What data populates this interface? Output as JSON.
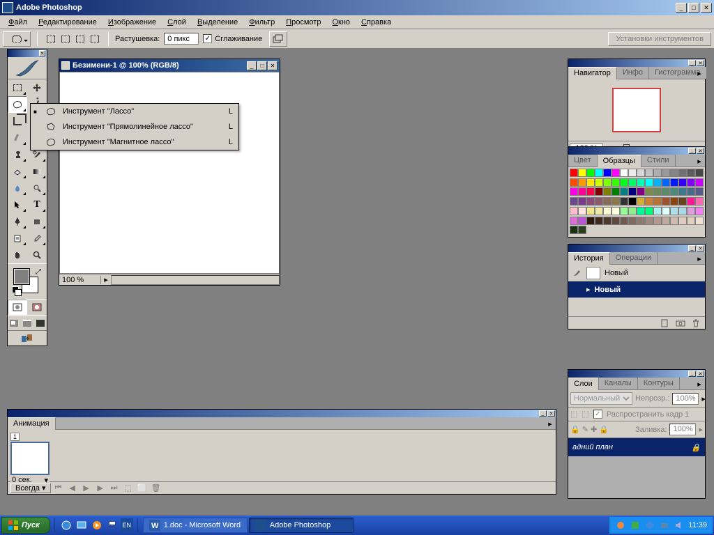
{
  "app": {
    "title": "Adobe Photoshop"
  },
  "menu": [
    "Файл",
    "Редактирование",
    "Изображение",
    "Слой",
    "Выделение",
    "Фильтр",
    "Просмотр",
    "Окно",
    "Справка"
  ],
  "options": {
    "feather_label": "Растушевка:",
    "feather_value": "0 пикс",
    "antialias": "Сглаживание",
    "presets": "Установки инструментов"
  },
  "document": {
    "title": "Безимени-1 @ 100% (RGB/8)",
    "zoom": "100 %"
  },
  "flyout": [
    {
      "mark": "■",
      "label": "Инструмент \"Лассо\"",
      "key": "L"
    },
    {
      "mark": "",
      "label": "Инструмент \"Прямолинейное лассо\"",
      "key": "L"
    },
    {
      "mark": "",
      "label": "Инструмент \"Магнитное лассо\"",
      "key": "L"
    }
  ],
  "navigator": {
    "tabs": [
      "Навигатор",
      "Инфо",
      "Гистограмма"
    ],
    "zoom": "100 %"
  },
  "swatches": {
    "tabs": [
      "Цвет",
      "Образцы",
      "Стили"
    ],
    "colors": [
      "#ff0000",
      "#ffff00",
      "#00ff00",
      "#00ffff",
      "#0000ff",
      "#ff00ff",
      "#ffffff",
      "#ebebeb",
      "#d6d6d6",
      "#c2c2c2",
      "#adadad",
      "#999999",
      "#858585",
      "#707070",
      "#5c5c5c",
      "#474747",
      "#ff4d00",
      "#ff9900",
      "#ffe600",
      "#ccff00",
      "#80ff00",
      "#33ff00",
      "#00ff1a",
      "#00ff66",
      "#00ffb3",
      "#00ffff",
      "#00b3ff",
      "#0066ff",
      "#001aff",
      "#3300ff",
      "#8000ff",
      "#cc00ff",
      "#ff00e6",
      "#ff0099",
      "#ff004d",
      "#800000",
      "#808000",
      "#008000",
      "#008080",
      "#000080",
      "#800080",
      "#7a8a4a",
      "#6a8a5a",
      "#5a8a6a",
      "#4a8a7a",
      "#3a7a8a",
      "#4a6a8a",
      "#5a5a8a",
      "#6a4a8a",
      "#7a3a8a",
      "#8a4a7a",
      "#8a5a6a",
      "#8a6a5a",
      "#8a7a4a",
      "#333333",
      "#000000",
      "#d4af37",
      "#cd7f32",
      "#b87333",
      "#a0522d",
      "#8b4513",
      "#654321",
      "#ff1493",
      "#ff69b4",
      "#ffc0cb",
      "#ffe4e1",
      "#f0e68c",
      "#eee8aa",
      "#fafad2",
      "#ffffe0",
      "#98fb98",
      "#90ee90",
      "#00fa9a",
      "#00ff7f",
      "#afeeee",
      "#e0ffff",
      "#b0e0e6",
      "#add8e6",
      "#dda0dd",
      "#ee82ee",
      "#da70d6",
      "#ba55d3",
      "#2f1a0f",
      "#3f2a1f",
      "#4f3a2f",
      "#5f4a3f",
      "#6f5a4f",
      "#7f6a5f",
      "#8f7a6f",
      "#9f8a7f",
      "#af9a8f",
      "#bfaa9f",
      "#cfbaaf",
      "#dfcabf",
      "#e0d0c0",
      "#f0e0d0",
      "#1a2f0f",
      "#2a3f1f"
    ]
  },
  "history": {
    "tabs": [
      "История",
      "Операции"
    ],
    "snapshot": "Новый",
    "state": "Новый"
  },
  "layers": {
    "tabs": [
      "Слои",
      "Каналы",
      "Контуры"
    ],
    "blend": "Нормальный",
    "opacity_label": "Непрозр.:",
    "opacity": "100%",
    "propagate": "Распространить кадр 1",
    "lock_label": "⬢ 🔒 ✚ 🔒",
    "fill_label": "Заливка:",
    "fill": "100%",
    "layer_name": "адний план"
  },
  "animation": {
    "tab": "Анимация",
    "frame_num": "1",
    "frame_time": "0 сек.",
    "loop": "Всегда"
  },
  "taskbar": {
    "start": "Пуск",
    "tasks": [
      {
        "label": "1.doc - Microsoft Word",
        "active": false
      },
      {
        "label": "Adobe Photoshop",
        "active": true
      }
    ],
    "time": "11:39"
  }
}
